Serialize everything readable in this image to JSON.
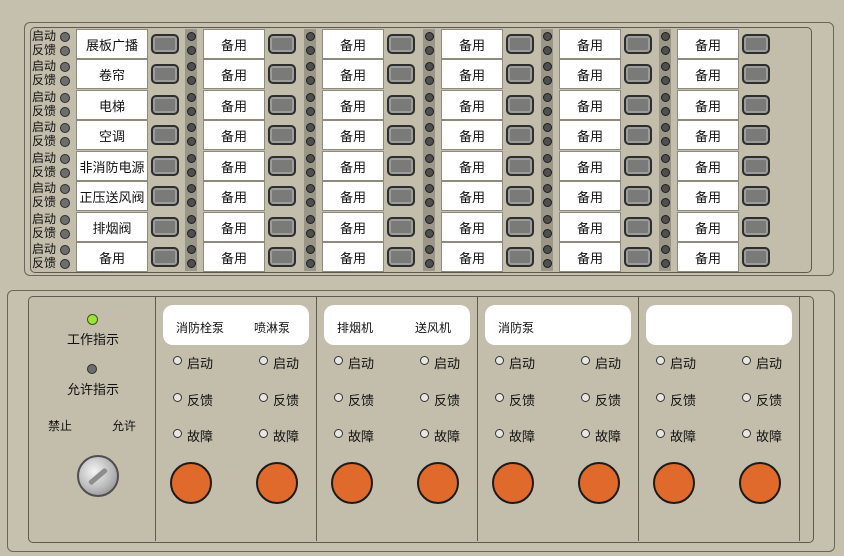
{
  "top_panel": {
    "row_indicators": [
      {
        "start": "启动",
        "feedback": "反馈"
      },
      {
        "start": "启动",
        "feedback": "反馈"
      },
      {
        "start": "启动",
        "feedback": "反馈"
      },
      {
        "start": "启动",
        "feedback": "反馈"
      },
      {
        "start": "启动",
        "feedback": "反馈"
      },
      {
        "start": "启动",
        "feedback": "反馈"
      },
      {
        "start": "启动",
        "feedback": "反馈"
      },
      {
        "start": "启动",
        "feedback": "反馈"
      }
    ],
    "columns": [
      {
        "labels": [
          "展板广播",
          "卷帘",
          "电梯",
          "空调",
          "非消防电源",
          "正压送风阀",
          "排烟阀",
          "备用"
        ]
      },
      {
        "labels": [
          "备用",
          "备用",
          "备用",
          "备用",
          "备用",
          "备用",
          "备用",
          "备用"
        ]
      },
      {
        "labels": [
          "备用",
          "备用",
          "备用",
          "备用",
          "备用",
          "备用",
          "备用",
          "备用"
        ]
      },
      {
        "labels": [
          "备用",
          "备用",
          "备用",
          "备用",
          "备用",
          "备用",
          "备用",
          "备用"
        ]
      },
      {
        "labels": [
          "备用",
          "备用",
          "备用",
          "备用",
          "备用",
          "备用",
          "备用",
          "备用"
        ]
      },
      {
        "labels": [
          "备用",
          "备用",
          "备用",
          "备用",
          "备用",
          "备用",
          "备用",
          "备用"
        ]
      }
    ]
  },
  "bottom_panel": {
    "work_indicator": "工作指示",
    "allow_indicator": "允许指示",
    "forbid_label": "禁止",
    "allow_label": "允许",
    "groups": [
      {
        "titles": [
          "消防栓泵",
          "喷淋泵"
        ]
      },
      {
        "titles": [
          "排烟机",
          "送风机"
        ]
      },
      {
        "titles": [
          "消防泵",
          ""
        ]
      },
      {
        "titles": [
          "",
          ""
        ]
      }
    ],
    "status_labels": [
      "启动",
      "反馈",
      "故障"
    ]
  },
  "colors": {
    "background": "#c5bfae",
    "button_orange": "#e06a2b",
    "work_lamp_green": "#9be23a"
  }
}
